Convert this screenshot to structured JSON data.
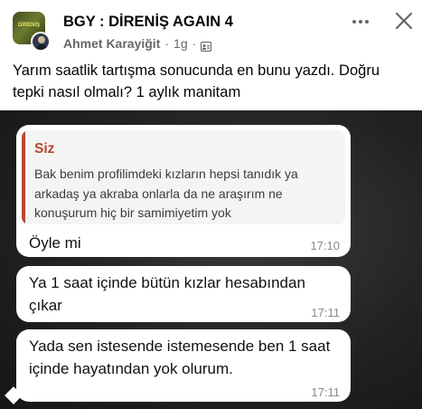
{
  "header": {
    "group_name": "BGY : DİRENİŞ AGAIN 4",
    "group_avatar_text": "DİRENİŞ",
    "author": "Ahmet Karayiğit",
    "separator": "·",
    "time": "1g",
    "separator2": "·",
    "privacy_icon": "group-privacy-icon"
  },
  "actions": {
    "more_icon": "more-horizontal-icon",
    "close_icon": "close-icon"
  },
  "post": {
    "text": "Yarım saatlik tartışma sonucunda en bunu yazdı. Doğru tepki nasıl olmalı? 1 aylık manitam"
  },
  "chat": {
    "quote_sender": "Siz",
    "quote_text": "Bak benim profilimdeki kızların hepsi tanıdık ya arkadaş ya akraba onlarla da ne araşırım ne konuşurum hiç bir samimiyetim yok",
    "messages": [
      {
        "text": "Öyle mi",
        "time": "17:10"
      },
      {
        "text": "Ya 1 saat içinde bütün kızlar hesabından çıkar",
        "time": "17:11"
      },
      {
        "text": "Yada sen istesende istemesende ben 1 saat içinde hayatından yok olurum.",
        "time": "17:11"
      }
    ]
  },
  "colors": {
    "quote_accent": "#b9462f",
    "meta_gray": "#65676b",
    "photo_background": "#1c1c1c"
  }
}
